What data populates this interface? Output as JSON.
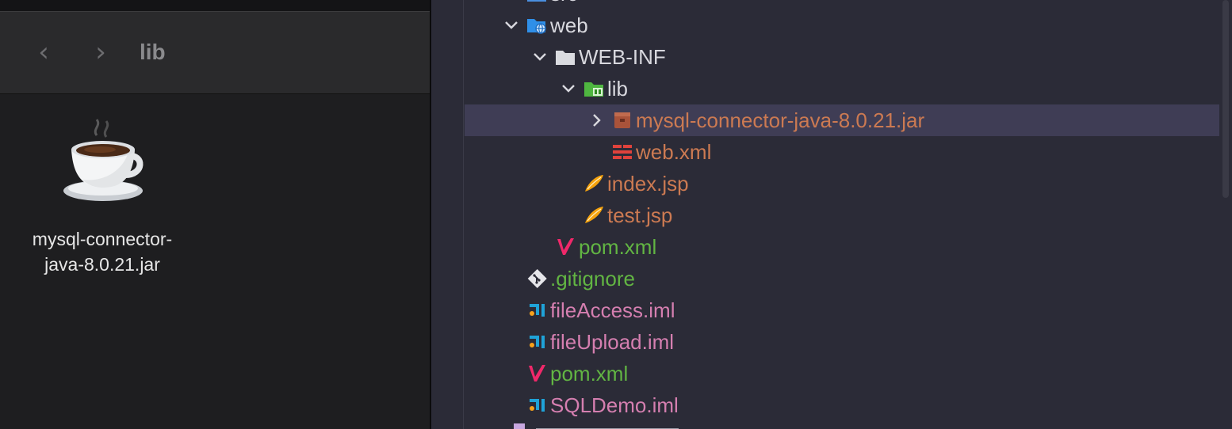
{
  "finder": {
    "back_glyph": "‹",
    "forward_glyph": "›",
    "folder_title": "lib",
    "file": {
      "name": "mysql-connector-\njava-8.0.21.jar",
      "icon": "coffee-cup-icon"
    }
  },
  "ide": {
    "colors": {
      "background": "#2b2b37",
      "selected_row": "#3f3d55",
      "folder_text": "#d8d8de",
      "excluded_text": "#cc7a52",
      "new_file_text": "#62b543",
      "pink_file_text": "#d57fb0"
    },
    "tree": [
      {
        "label": "src",
        "icon": "source-folder-icon",
        "expanded": false,
        "depth": 0
      },
      {
        "label": "web",
        "icon": "web-folder-icon",
        "expanded": true,
        "depth": 0
      },
      {
        "label": "WEB-INF",
        "icon": "folder-icon",
        "expanded": true,
        "depth": 1
      },
      {
        "label": "lib",
        "icon": "library-folder-icon",
        "expanded": true,
        "depth": 2
      },
      {
        "label": "mysql-connector-java-8.0.21.jar",
        "icon": "jar-archive-icon",
        "expanded": false,
        "depth": 3,
        "selected": true
      },
      {
        "label": "web.xml",
        "icon": "web-xml-icon",
        "depth": 3
      },
      {
        "label": "index.jsp",
        "icon": "jsp-file-icon",
        "depth": 2
      },
      {
        "label": "test.jsp",
        "icon": "jsp-file-icon",
        "depth": 2
      },
      {
        "label": "pom.xml",
        "icon": "maven-icon",
        "depth": 1
      },
      {
        "label": ".gitignore",
        "icon": "git-icon",
        "depth": 0
      },
      {
        "label": "fileAccess.iml",
        "icon": "iml-module-icon",
        "depth": 0
      },
      {
        "label": "fileUpload.iml",
        "icon": "iml-module-icon",
        "depth": 0
      },
      {
        "label": "pom.xml",
        "icon": "maven-icon",
        "depth": 0
      },
      {
        "label": "SQLDemo.iml",
        "icon": "iml-module-icon",
        "depth": 0
      }
    ]
  }
}
